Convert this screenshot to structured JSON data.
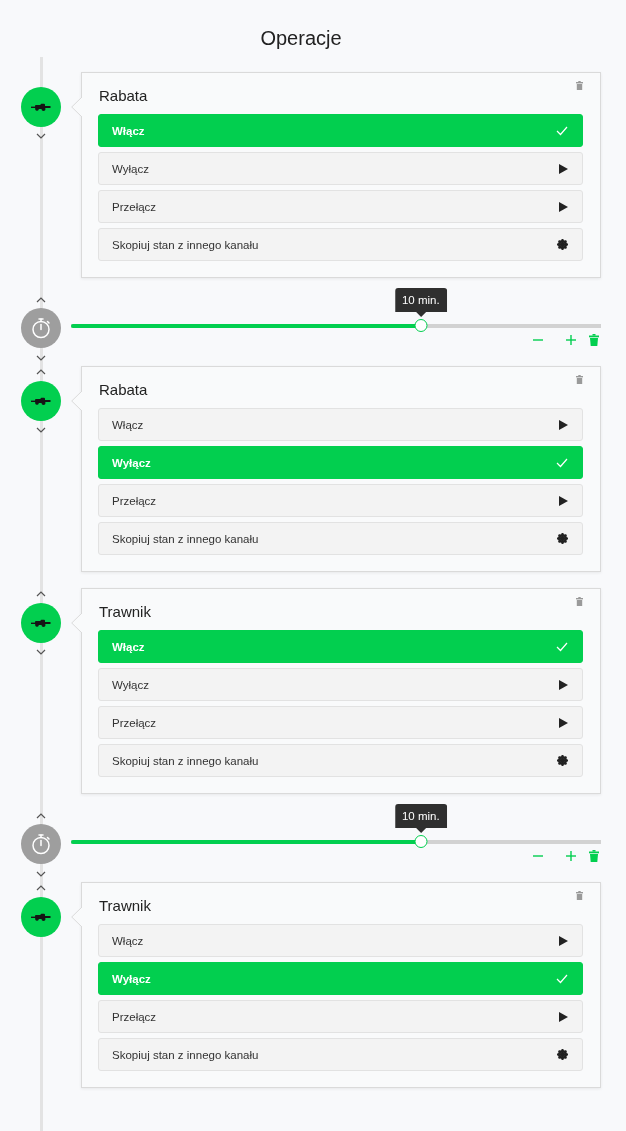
{
  "title": "Operacje",
  "steps": [
    {
      "kind": "channel",
      "name": "Rabata",
      "actions": [
        {
          "kind": "command",
          "label": "Włącz",
          "selected": true
        },
        {
          "kind": "command",
          "label": "Wyłącz",
          "selected": false
        },
        {
          "kind": "command",
          "label": "Przełącz",
          "selected": false
        },
        {
          "kind": "settings",
          "label": "Skopiuj stan z innego kanału",
          "selected": false
        }
      ]
    },
    {
      "kind": "delay",
      "duration": "10 min.",
      "level": 0.66
    },
    {
      "kind": "channel",
      "name": "Rabata",
      "actions": [
        {
          "kind": "command",
          "label": "Włącz",
          "selected": false
        },
        {
          "kind": "command",
          "label": "Wyłącz",
          "selected": true
        },
        {
          "kind": "command",
          "label": "Przełącz",
          "selected": false
        },
        {
          "kind": "settings",
          "label": "Skopiuj stan z innego kanału",
          "selected": false
        }
      ]
    },
    {
      "kind": "channel",
      "name": "Trawnik",
      "actions": [
        {
          "kind": "command",
          "label": "Włącz",
          "selected": true
        },
        {
          "kind": "command",
          "label": "Wyłącz",
          "selected": false
        },
        {
          "kind": "command",
          "label": "Przełącz",
          "selected": false
        },
        {
          "kind": "settings",
          "label": "Skopiuj stan z innego kanału",
          "selected": false
        }
      ]
    },
    {
      "kind": "delay",
      "duration": "10 min.",
      "level": 0.66
    },
    {
      "kind": "channel",
      "name": "Trawnik",
      "actions": [
        {
          "kind": "command",
          "label": "Włącz",
          "selected": false
        },
        {
          "kind": "command",
          "label": "Wyłącz",
          "selected": true
        },
        {
          "kind": "command",
          "label": "Przełącz",
          "selected": false
        },
        {
          "kind": "settings",
          "label": "Skopiuj stan z innego kanału",
          "selected": false
        }
      ]
    }
  ]
}
